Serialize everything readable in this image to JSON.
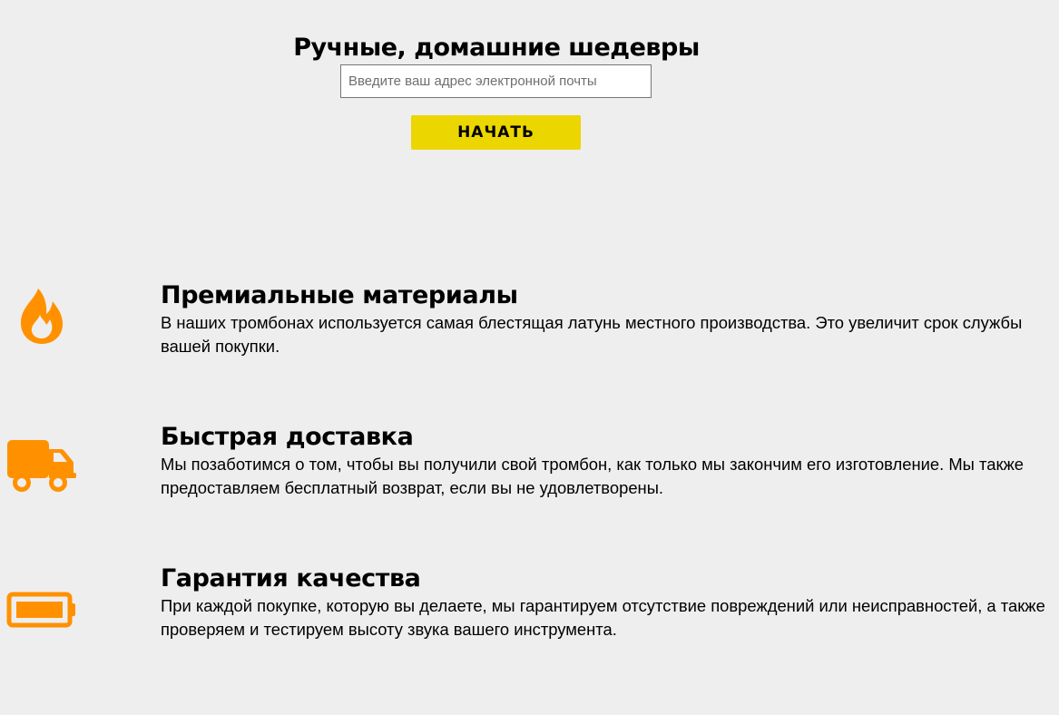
{
  "hero": {
    "title": "Ручные, домашние шедевры",
    "email_placeholder": "Введите ваш адрес электронной почты",
    "email_value": "",
    "start_label": "НАЧАТЬ"
  },
  "features": [
    {
      "icon": "fire-icon",
      "title": "Премиальные материалы",
      "description": "В наших тромбонах используется самая блестящая латунь местного производства. Это увеличит срок службы вашей покупки."
    },
    {
      "icon": "truck-icon",
      "title": "Быстрая доставка",
      "description": "Мы позаботимся о том, чтобы вы получили свой тромбон, как только мы закончим его изготовление. Мы также предоставляем бесплатный возврат, если вы не удовлетворены."
    },
    {
      "icon": "battery-full-icon",
      "title": "Гарантия качества",
      "description": "При каждой покупке, которую вы делаете, мы гарантируем отсутствие повреждений или неисправностей, а также проверяем и тестируем высоту звука вашего инструмента."
    }
  ],
  "colors": {
    "background": "#eeeeee",
    "accent_button": "#ecd600",
    "icon": "#ff9100"
  }
}
